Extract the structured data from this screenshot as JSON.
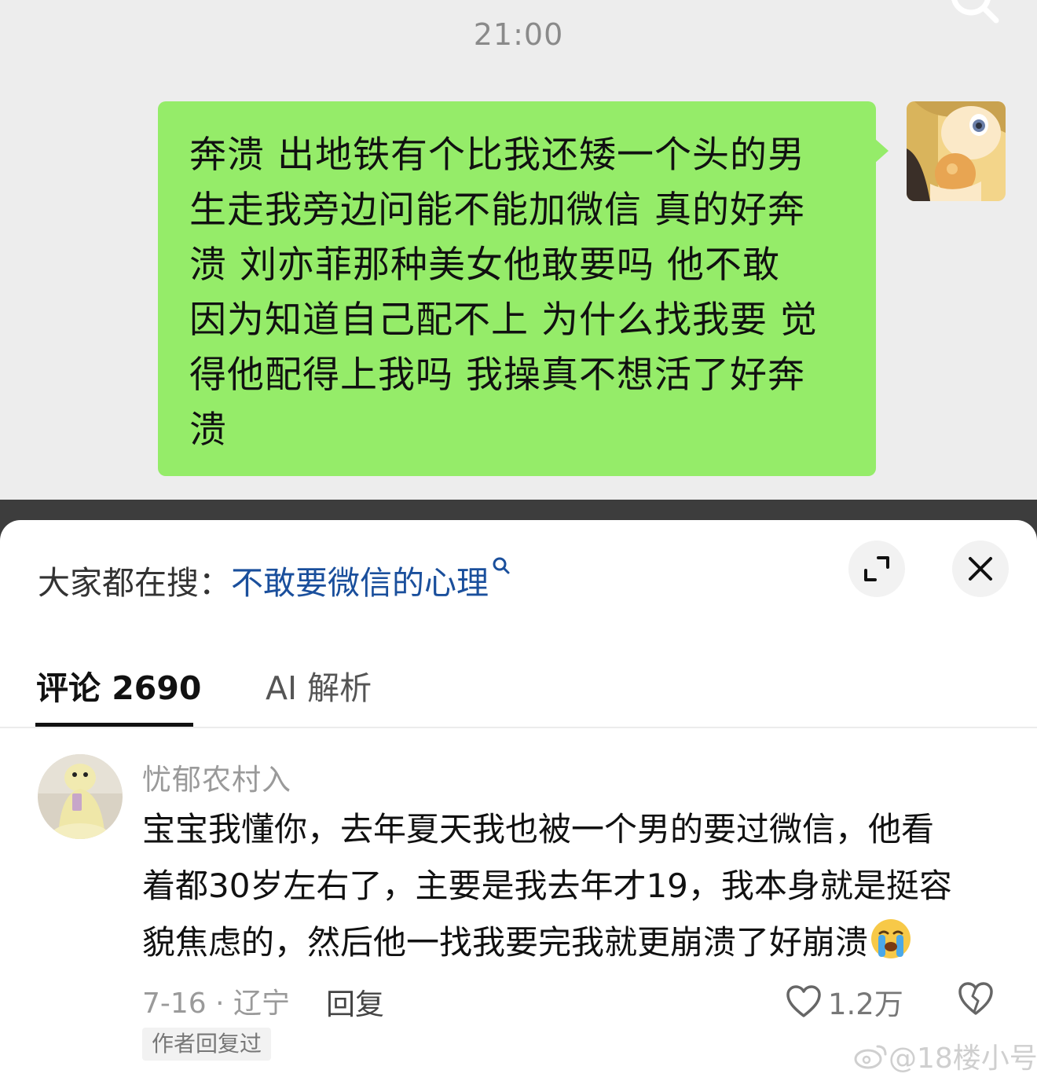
{
  "chat": {
    "time": "21:00",
    "message_lines": [
      "奔溃 出地铁有个比我还矮一个头的男",
      "生走我旁边问能不能加微信 真的好奔",
      "溃 刘亦菲那种美女他敢要吗 他不敢",
      "因为知道自己配不上 为什么找我要 觉",
      "得他配得上我吗 我操真不想活了好奔",
      "溃"
    ],
    "bubble_color": "#95ec69"
  },
  "sheet": {
    "search_prefix": "大家都在搜：",
    "search_term": "不敢要微信的心理",
    "search_term_color": "#1a4f9c",
    "expand_icon": "expand-icon",
    "close_icon": "close-icon",
    "tabs": [
      {
        "label": "评论 2690",
        "active": true
      },
      {
        "label": "AI 解析",
        "active": false
      }
    ]
  },
  "comment": {
    "username": "忧郁农村入",
    "lines": [
      "宝宝我懂你，去年夏天我也被一个男的要过微信，他看",
      "着都30岁左右了，主要是我去年才19，我本身就是挺容",
      "貌焦虑的，然后他一找我要完我就更崩溃了好崩溃"
    ],
    "emoji": "crying-emoji",
    "meta": "7-16 · 辽宁",
    "reply_label": "回复",
    "like_count": "1.2万",
    "author_badge": "作者回复过"
  },
  "watermark": "@18楼小号"
}
